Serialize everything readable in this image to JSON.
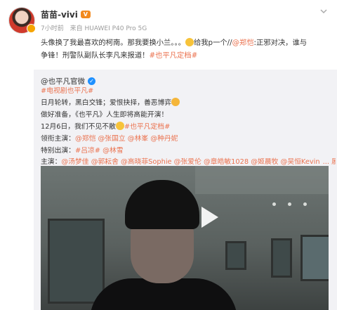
{
  "post": {
    "username": "苗苗-vivi",
    "vip_badge": "V",
    "time": "7小时前",
    "source": "来自 HUAWEI P40 Pro 5G",
    "content": {
      "line1_a": "头像换了我最喜欢的柯南。那我要换小兰。。。",
      "line1_b": "给我p一个//",
      "line1_mention": "@郑恺",
      "line1_c": ":正邪对决，谁与",
      "line2_a": "争锋！刑警队副队长李凡来报道！",
      "line2_topic": "#也平凡定档#"
    }
  },
  "repost": {
    "author": "@也平凡官微",
    "verified_icon": "✓",
    "lines": [
      {
        "text": "#电视剧也平凡#",
        "link": true
      },
      {
        "text": "日月轮转，黑白交锋；爱恨抉择，善恶博弈",
        "link": false
      },
      {
        "text": "做好准备，《也平凡》人生即将高能开演！",
        "link": false
      },
      {
        "text": "12月6日，我们不见不散",
        "suffix": "#也平凡定档#",
        "link": false
      },
      {
        "text": "领衔主演：",
        "suffix": "@郑恺 @张国立 @林峯 @种丹妮",
        "link": false
      },
      {
        "text": "特别出演：",
        "suffix": "#吕凉# @林雪",
        "link": false
      },
      {
        "text": "主演：",
        "suffix": "@汤梦佳 @郭耘舍 @高晓菲Sophie @张爱伦 @章皓敏1028 @姬晨牧 @吴恒Kevin",
        "more": "... 展开",
        "link": false
      }
    ]
  },
  "icons": {
    "chevron": "chevron-down-icon",
    "play": "play-icon"
  },
  "colors": {
    "link": "#eb7350",
    "meta_gray": "#9b9b9b",
    "repost_bg": "#f2f2f5",
    "verified_blue": "#1e90ff",
    "vip_orange": "#f28a1f"
  }
}
